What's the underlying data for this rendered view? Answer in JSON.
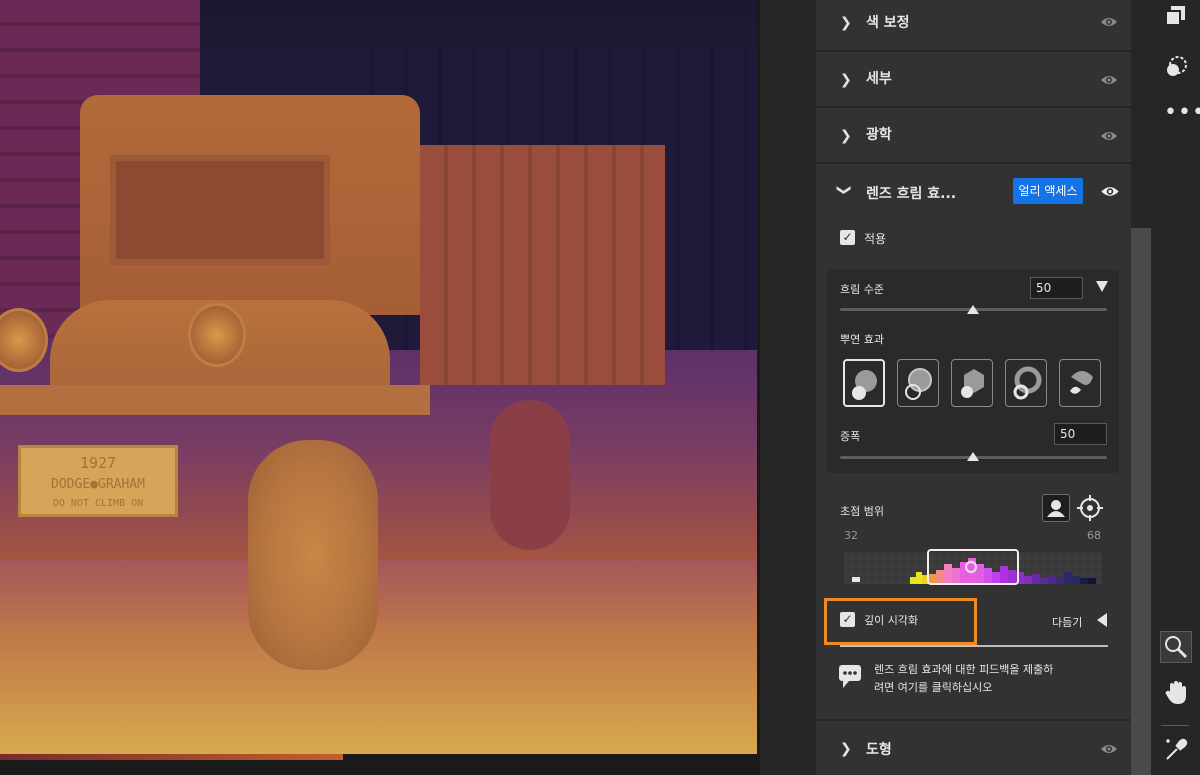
{
  "photo": {
    "plate_line1": "1927",
    "plate_line2": "DODGE●GRAHAM",
    "plate_line3": "DO NOT CLIMB ON"
  },
  "panel": {
    "sections": [
      {
        "label": "색 보정"
      },
      {
        "label": "세부"
      },
      {
        "label": "광학"
      }
    ],
    "lens_blur": {
      "title": "렌즈 흐림 효...",
      "badge": "얼리 액세스",
      "apply_label": "적용",
      "apply_checked": true,
      "blur_amount_label": "흐림 수준",
      "blur_amount_value": "50",
      "blur_amount_fraction": 0.5,
      "bokeh_label": "뿌연 효과",
      "bokeh_selected_index": 0,
      "boost_label": "증폭",
      "boost_value": "50",
      "boost_fraction": 0.5,
      "focal_range_label": "초점 범위",
      "range_min": "32",
      "range_max": "68",
      "visualize_depth_label": "깊이 시각화",
      "visualize_depth_checked": true,
      "refine_label": "다듬기",
      "feedback_text_line1": "렌즈 흐림 효과에 대한 피드백을 제출하",
      "feedback_text_line2": "려면 여기를 클릭하십시오"
    },
    "bottom_section": {
      "label": "도형"
    }
  },
  "colors": {
    "accent": "#1473e6",
    "highlight": "#f08a24",
    "panel_bg": "#323232"
  },
  "icons": [
    "chevron-right-icon",
    "chevron-down-icon",
    "eye-icon",
    "check-icon",
    "triangle-down-icon",
    "triangle-left-icon",
    "subject-focus-icon",
    "crosshair-icon",
    "comment-icon",
    "layers-icon",
    "healing-icon",
    "more-icon",
    "zoom-icon",
    "hand-icon",
    "eyedropper-icon"
  ]
}
